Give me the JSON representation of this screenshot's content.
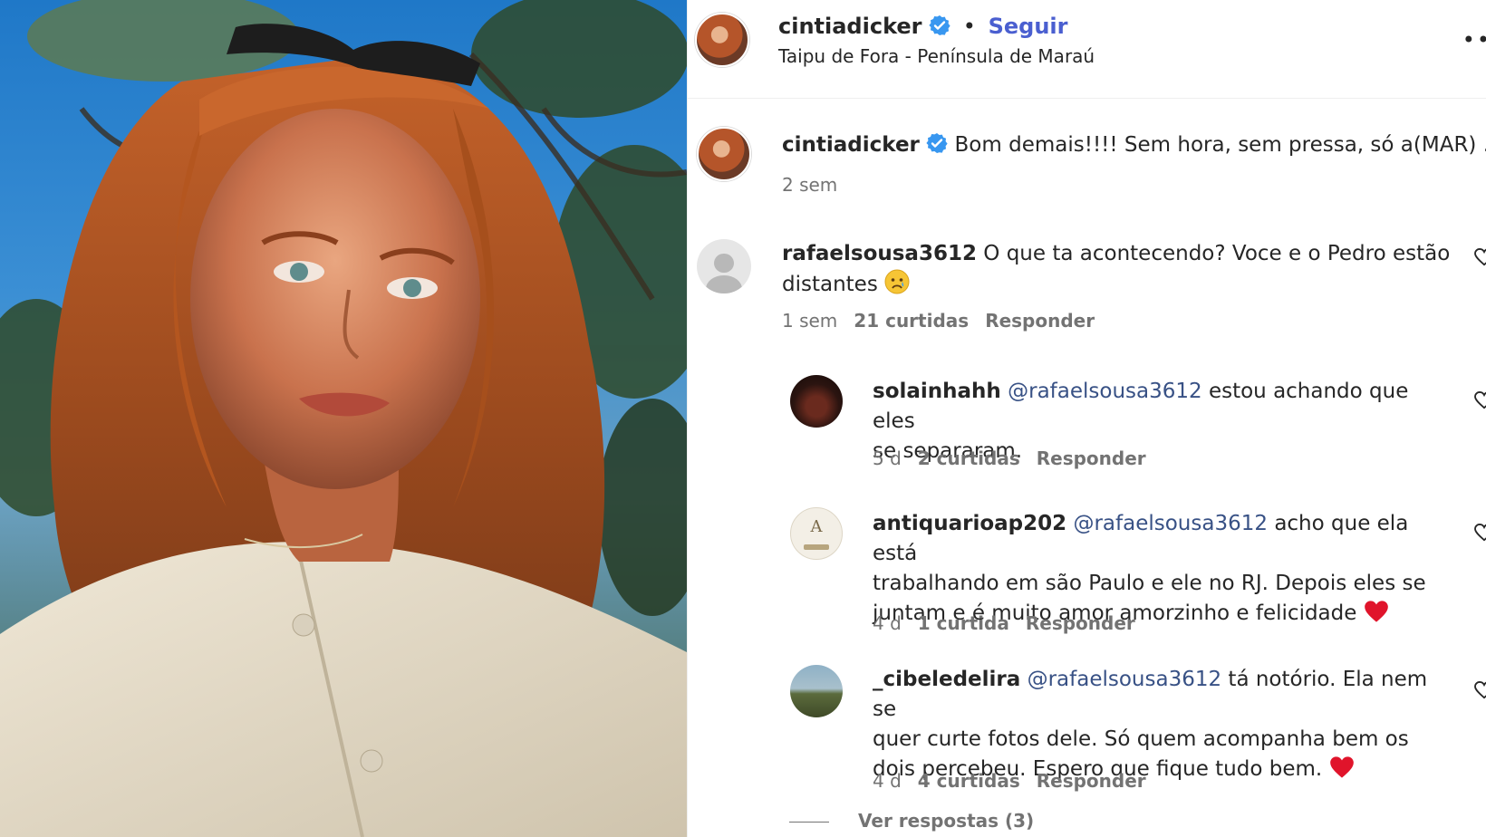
{
  "header": {
    "username": "cintiadicker",
    "separator": "•",
    "follow_label": "Seguir",
    "location": "Taipu de Fora - Península de Maraú",
    "more_icon": "more-options-icon"
  },
  "caption": {
    "username": "cintiadicker",
    "text": "Bom demais!!!! Sem hora, sem pressa, só a(MAR) .",
    "time": "2 sem"
  },
  "comments": [
    {
      "username": "rafaelsousa3612",
      "text_line1": "O que ta acontecendo? Voce e o Pedro estão",
      "text_line2": "distantes",
      "emoji": "sad-face-emoji",
      "time": "1 sem",
      "likes": "21 curtidas",
      "reply": "Responder"
    }
  ],
  "replies": [
    {
      "username": "solainhahh",
      "mention": "@rafaelsousa3612",
      "text_line1": "estou achando que eles",
      "text_line2": "se separaram.",
      "time": "5 d",
      "likes": "2 curtidas",
      "reply": "Responder"
    },
    {
      "username": "antiquarioap202",
      "mention": "@rafaelsousa3612",
      "text_line1": "acho que ela está",
      "text_line2": "trabalhando em são Paulo e ele no RJ. Depois eles se",
      "text_line3": "juntam e é muito amor amorzinho e felicidade",
      "emoji": "red-heart-emoji",
      "avatar_text": "A",
      "time": "4 d",
      "likes": "1 curtida",
      "reply": "Responder"
    },
    {
      "username": "_cibeledelira",
      "mention": "@rafaelsousa3612",
      "text_line1": "tá notório. Ela nem se",
      "text_line2": "quer curte fotos dele. Só quem acompanha bem os",
      "text_line3": "dois percebeu. Espero que fique tudo bem.",
      "emoji": "red-heart-emoji",
      "time": "4 d",
      "likes": "4 curtidas",
      "reply": "Responder"
    }
  ],
  "view_replies": "Ver respostas (3)",
  "colors": {
    "link": "#385185",
    "follow": "#4a5fd0",
    "verified": "#3897f0",
    "meta": "#737373",
    "heart": "#e0142b"
  }
}
